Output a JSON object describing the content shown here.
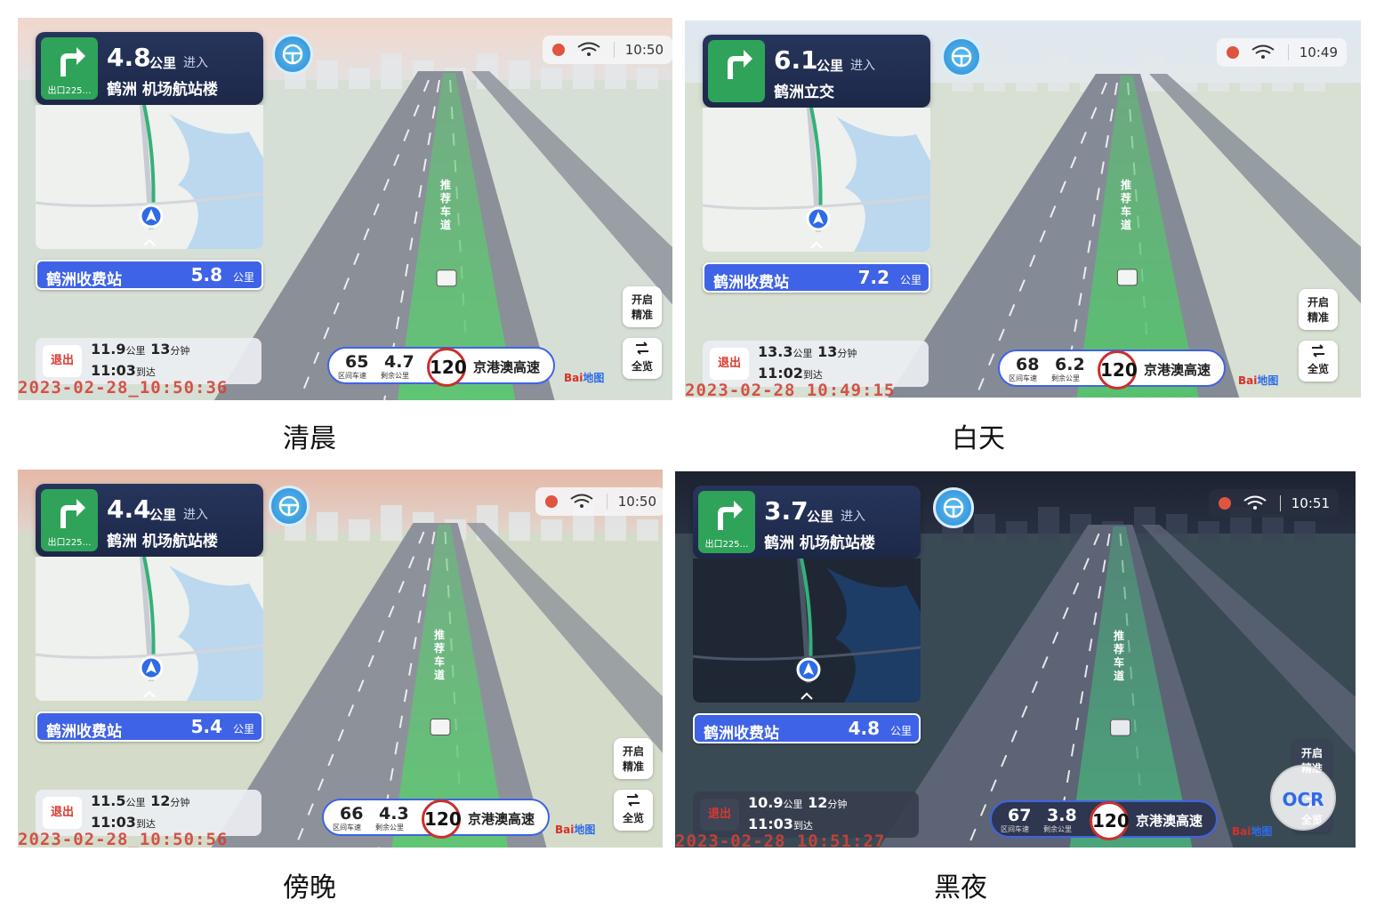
{
  "panels": [
    {
      "caption": "清晨",
      "turn_distance": "4.8",
      "turn_unit": "公里",
      "enter_label": "进入",
      "exit_label": "出口225…",
      "road": "鹤洲 机场航站楼",
      "toll_name": "鹤洲收费站",
      "toll_distance": "5.8",
      "toll_unit": "公里",
      "exit_button": "退出",
      "remain_km": "11.9",
      "remain_km_unit": "公里",
      "remain_min": "13",
      "remain_min_unit": "分钟",
      "arrive_time": "11:03",
      "arrive_unit": "到达",
      "clock": "10:50",
      "zone_speed": "65",
      "zone_speed_label": "区间车速",
      "remain_dist": "4.7",
      "remain_dist_label": "剩余公里",
      "speed_limit": "120",
      "highway": "京港澳高速",
      "precise_btn_1": "开启",
      "precise_btn_2": "精准",
      "overview_btn": "全览",
      "lane_label": "推荐车道",
      "timestamp": "2023-02-28_10:50:36"
    },
    {
      "caption": "白天",
      "turn_distance": "6.1",
      "turn_unit": "公里",
      "enter_label": "进入",
      "exit_label": "",
      "road": "鹤洲立交",
      "toll_name": "鹤洲收费站",
      "toll_distance": "7.2",
      "toll_unit": "公里",
      "exit_button": "退出",
      "remain_km": "13.3",
      "remain_km_unit": "公里",
      "remain_min": "13",
      "remain_min_unit": "分钟",
      "arrive_time": "11:02",
      "arrive_unit": "到达",
      "clock": "10:49",
      "zone_speed": "68",
      "zone_speed_label": "区间车速",
      "remain_dist": "6.2",
      "remain_dist_label": "剩余公里",
      "speed_limit": "120",
      "highway": "京港澳高速",
      "precise_btn_1": "开启",
      "precise_btn_2": "精准",
      "overview_btn": "全览",
      "lane_label": "推荐车道",
      "timestamp": "2023-02-28_10:49:15"
    },
    {
      "caption": "傍晚",
      "turn_distance": "4.4",
      "turn_unit": "公里",
      "enter_label": "进入",
      "exit_label": "出口225…",
      "road": "鹤洲 机场航站楼",
      "toll_name": "鹤洲收费站",
      "toll_distance": "5.4",
      "toll_unit": "公里",
      "exit_button": "退出",
      "remain_km": "11.5",
      "remain_km_unit": "公里",
      "remain_min": "12",
      "remain_min_unit": "分钟",
      "arrive_time": "11:03",
      "arrive_unit": "到达",
      "clock": "10:50",
      "zone_speed": "66",
      "zone_speed_label": "区间车速",
      "remain_dist": "4.3",
      "remain_dist_label": "剩余公里",
      "speed_limit": "120",
      "highway": "京港澳高速",
      "precise_btn_1": "开启",
      "precise_btn_2": "精准",
      "overview_btn": "全览",
      "lane_label": "推荐车道",
      "timestamp": "2023-02-28_10:50:56"
    },
    {
      "caption": "黑夜",
      "turn_distance": "3.7",
      "turn_unit": "公里",
      "enter_label": "进入",
      "exit_label": "出口225…",
      "road": "鹤洲 机场航站楼",
      "toll_name": "鹤洲收费站",
      "toll_distance": "4.8",
      "toll_unit": "公里",
      "exit_button": "退出",
      "remain_km": "10.9",
      "remain_km_unit": "公里",
      "remain_min": "12",
      "remain_min_unit": "分钟",
      "arrive_time": "11:03",
      "arrive_unit": "到达",
      "clock": "10:51",
      "zone_speed": "67",
      "zone_speed_label": "区间车速",
      "remain_dist": "3.8",
      "remain_dist_label": "剩余公里",
      "speed_limit": "120",
      "highway": "京港澳高速",
      "precise_btn_1": "开启",
      "precise_btn_2": "精准",
      "overview_btn": "全览",
      "lane_label": "推荐车道",
      "timestamp": "2023-02-28_10:51:27",
      "ocr_label": "OCR"
    }
  ],
  "brand": {
    "logo_red": "Bai",
    "logo_blue": "地图"
  },
  "colors": {
    "accent": "#3f63e6",
    "turn_green": "#2fa35a",
    "lane_green": "#4fc46c",
    "limit_red": "#c9302c",
    "timestamp_red": "#d24137"
  },
  "icons": [
    "turn-right-arrow-icon",
    "steering-wheel-icon",
    "wifi-icon",
    "alert-icon",
    "overview-icon"
  ]
}
